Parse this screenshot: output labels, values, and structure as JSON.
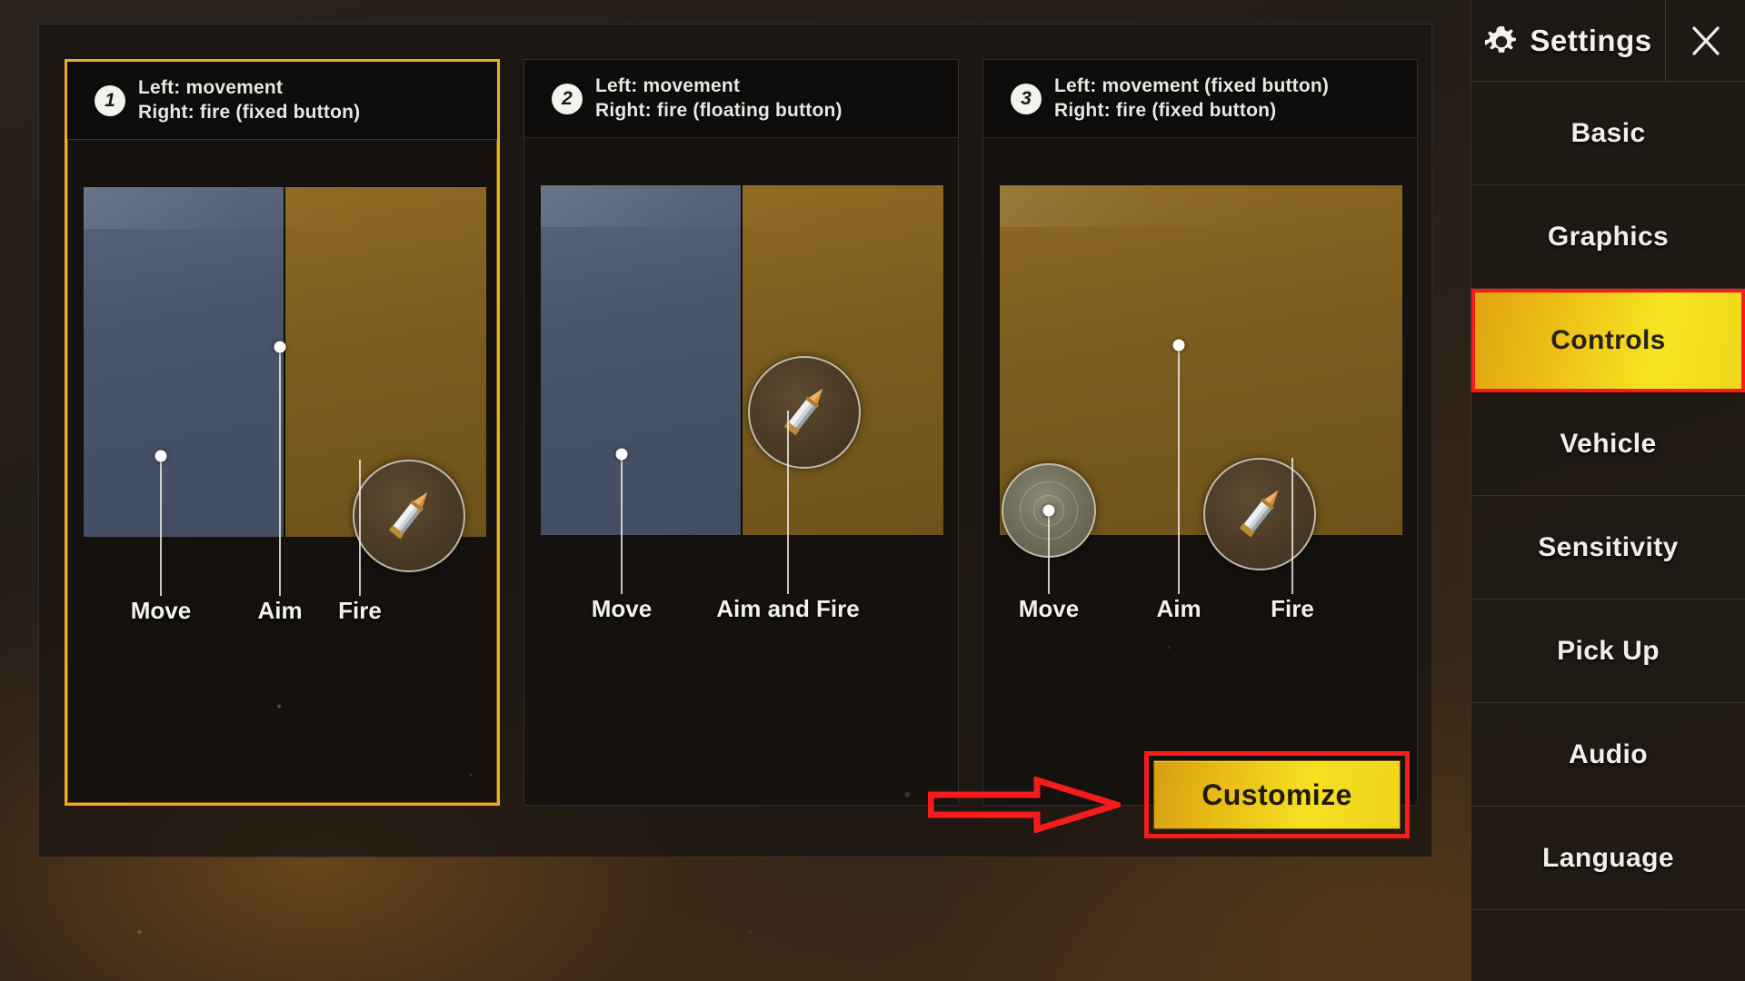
{
  "sidebar": {
    "title": "Settings",
    "gear_icon": "gear-icon",
    "close_icon": "close-x-icon",
    "items": [
      {
        "label": "Basic",
        "active": false
      },
      {
        "label": "Graphics",
        "active": false
      },
      {
        "label": "Controls",
        "active": true
      },
      {
        "label": "Vehicle",
        "active": false
      },
      {
        "label": "Sensitivity",
        "active": false
      },
      {
        "label": "Pick Up",
        "active": false
      },
      {
        "label": "Audio",
        "active": false
      },
      {
        "label": "Language",
        "active": false
      }
    ],
    "active_highlight_color": "#f6e521",
    "annotation_color": "#f71c1c"
  },
  "main": {
    "customize_label": "Customize",
    "schemes": [
      {
        "number": "1",
        "line1": "Left: movement",
        "line2": "Right: fire (fixed button)",
        "selected": true,
        "layout": "split",
        "labels": [
          "Move",
          "Aim",
          "Fire"
        ]
      },
      {
        "number": "2",
        "line1": "Left: movement",
        "line2": "Right: fire (floating button)",
        "selected": false,
        "layout": "split",
        "labels": [
          "Move",
          "Aim and Fire"
        ]
      },
      {
        "number": "3",
        "line1": "Left: movement (fixed button)",
        "line2": "Right: fire (fixed button)",
        "selected": false,
        "layout": "full-fire",
        "labels": [
          "Move",
          "Aim",
          "Fire"
        ]
      }
    ]
  },
  "colors": {
    "selected_card_border": "#f0ab22",
    "move_zone": "#4a5468",
    "fire_zone": "#7b5c1e",
    "customize_button": "#f4e021",
    "annotation_red": "#f71c1c"
  }
}
